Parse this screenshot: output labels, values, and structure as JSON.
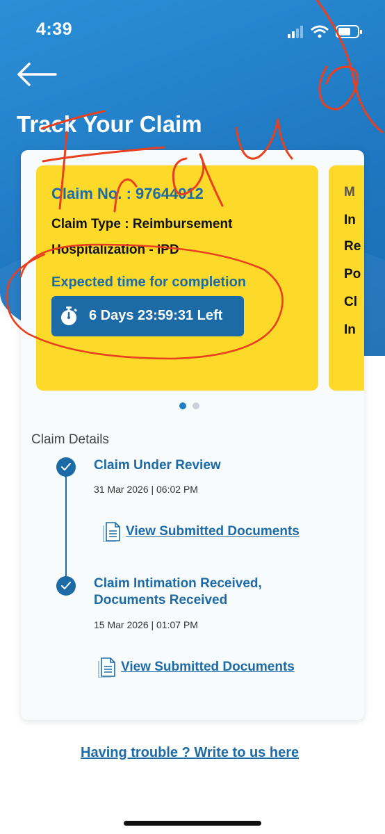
{
  "status_bar": {
    "time": "4:39"
  },
  "header": {
    "title": "Track Your Claim"
  },
  "claim_card": {
    "claim_no": "Claim No. : 97644012",
    "claim_type": "Claim Type : Reimbursement",
    "sub_type": "Hospitalization - IPD",
    "expected_label": "Expected time for completion",
    "timer": "6 Days 23:59:31 Left"
  },
  "peek_card": {
    "lines": [
      "M",
      "In",
      "Re",
      "Po",
      "Cl",
      "In"
    ]
  },
  "pager": {
    "total": 2,
    "active": 1
  },
  "details": {
    "title": "Claim Details",
    "steps": [
      {
        "title_line1": "Claim Under Review",
        "title_line2": "",
        "date": "31 Mar 2026 | 06:02 PM",
        "link": "View Submitted Documents"
      },
      {
        "title_line1": "Claim Intimation Received,",
        "title_line2": "Documents Received",
        "date": "15 Mar 2026 | 01:07 PM",
        "link": "View Submitted Documents"
      }
    ]
  },
  "help": {
    "link": "Having trouble ? Write to us here"
  },
  "colors": {
    "primary": "#1c6aa6",
    "card_yellow": "#fdd92a",
    "hero_blue": "#2088cf",
    "annotation_red": "#e8401f"
  },
  "annotation": {
    "handwritten_text": "Fraud"
  }
}
